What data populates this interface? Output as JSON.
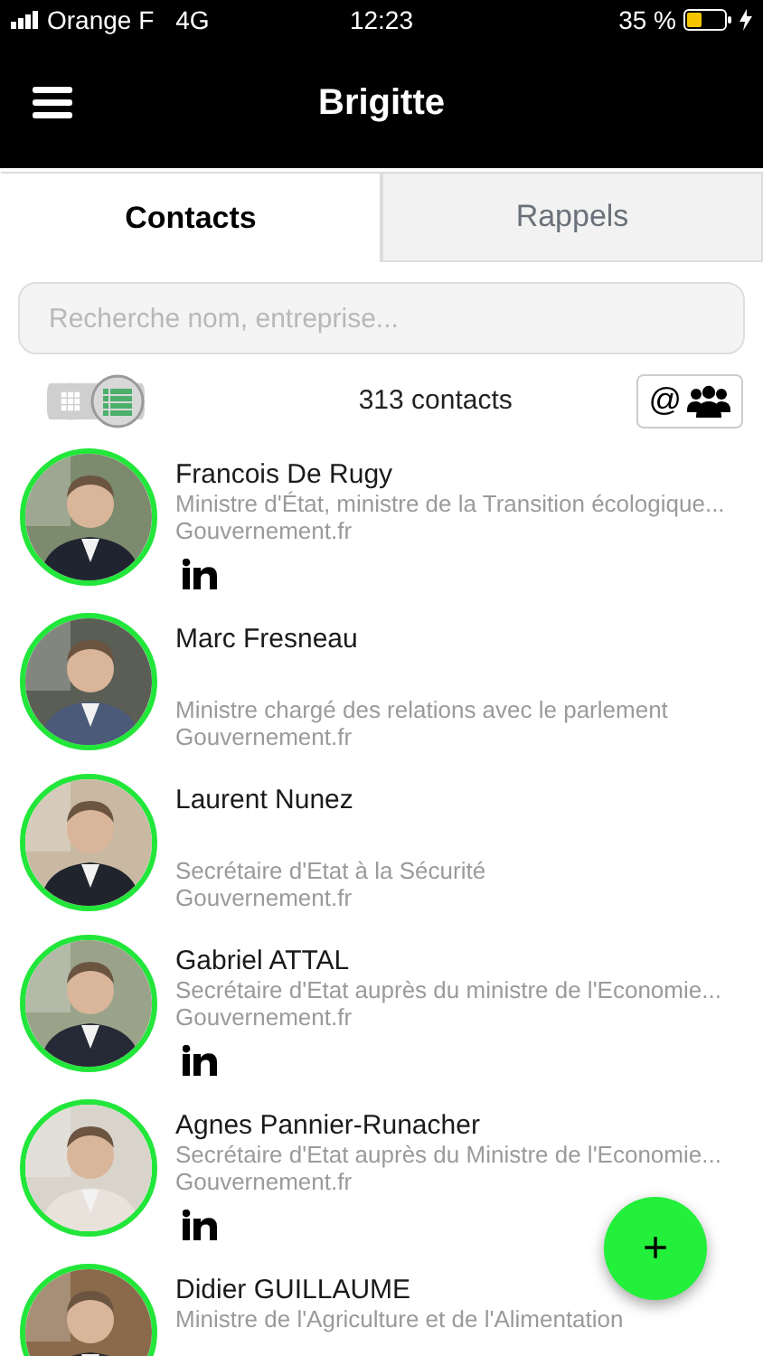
{
  "status_bar": {
    "carrier": "Orange F",
    "network": "4G",
    "time": "12:23",
    "battery": "35 %"
  },
  "header": {
    "title": "Brigitte"
  },
  "tabs": [
    {
      "label": "Contacts",
      "selected": true
    },
    {
      "label": "Rappels",
      "selected": false
    }
  ],
  "search": {
    "placeholder": "Recherche nom, entreprise..."
  },
  "view_modes": [
    {
      "kind": "grid",
      "selected": false
    },
    {
      "kind": "list",
      "selected": true
    }
  ],
  "count": "313 contacts",
  "filter_button": {
    "label": "@"
  },
  "contacts": [
    {
      "name": "Francois De Rugy",
      "title": "Ministre d'État, ministre de la Transition écologique...",
      "organization": "Gouvernement.fr",
      "linkedin": true
    },
    {
      "name": "Marc Fresneau",
      "title": "Ministre chargé des relations avec le parlement",
      "organization": "Gouvernement.fr",
      "linkedin": false
    },
    {
      "name": "Laurent Nunez",
      "title": "Secrétaire d'Etat à la Sécurité",
      "organization": "Gouvernement.fr",
      "linkedin": false
    },
    {
      "name": "Gabriel ATTAL",
      "title": "Secrétaire d'Etat auprès du ministre de l'Economie...",
      "organization": "Gouvernement.fr",
      "linkedin": true
    },
    {
      "name": "Agnes Pannier-Runacher",
      "title": "Secrétaire d'Etat auprès du Ministre de l'Economie...",
      "organization": "Gouvernement.fr",
      "linkedin": true
    },
    {
      "name": "Didier GUILLAUME",
      "title": "Ministre de l'Agriculture et de l'Alimentation"
    }
  ],
  "add_button": {
    "label": "+"
  }
}
